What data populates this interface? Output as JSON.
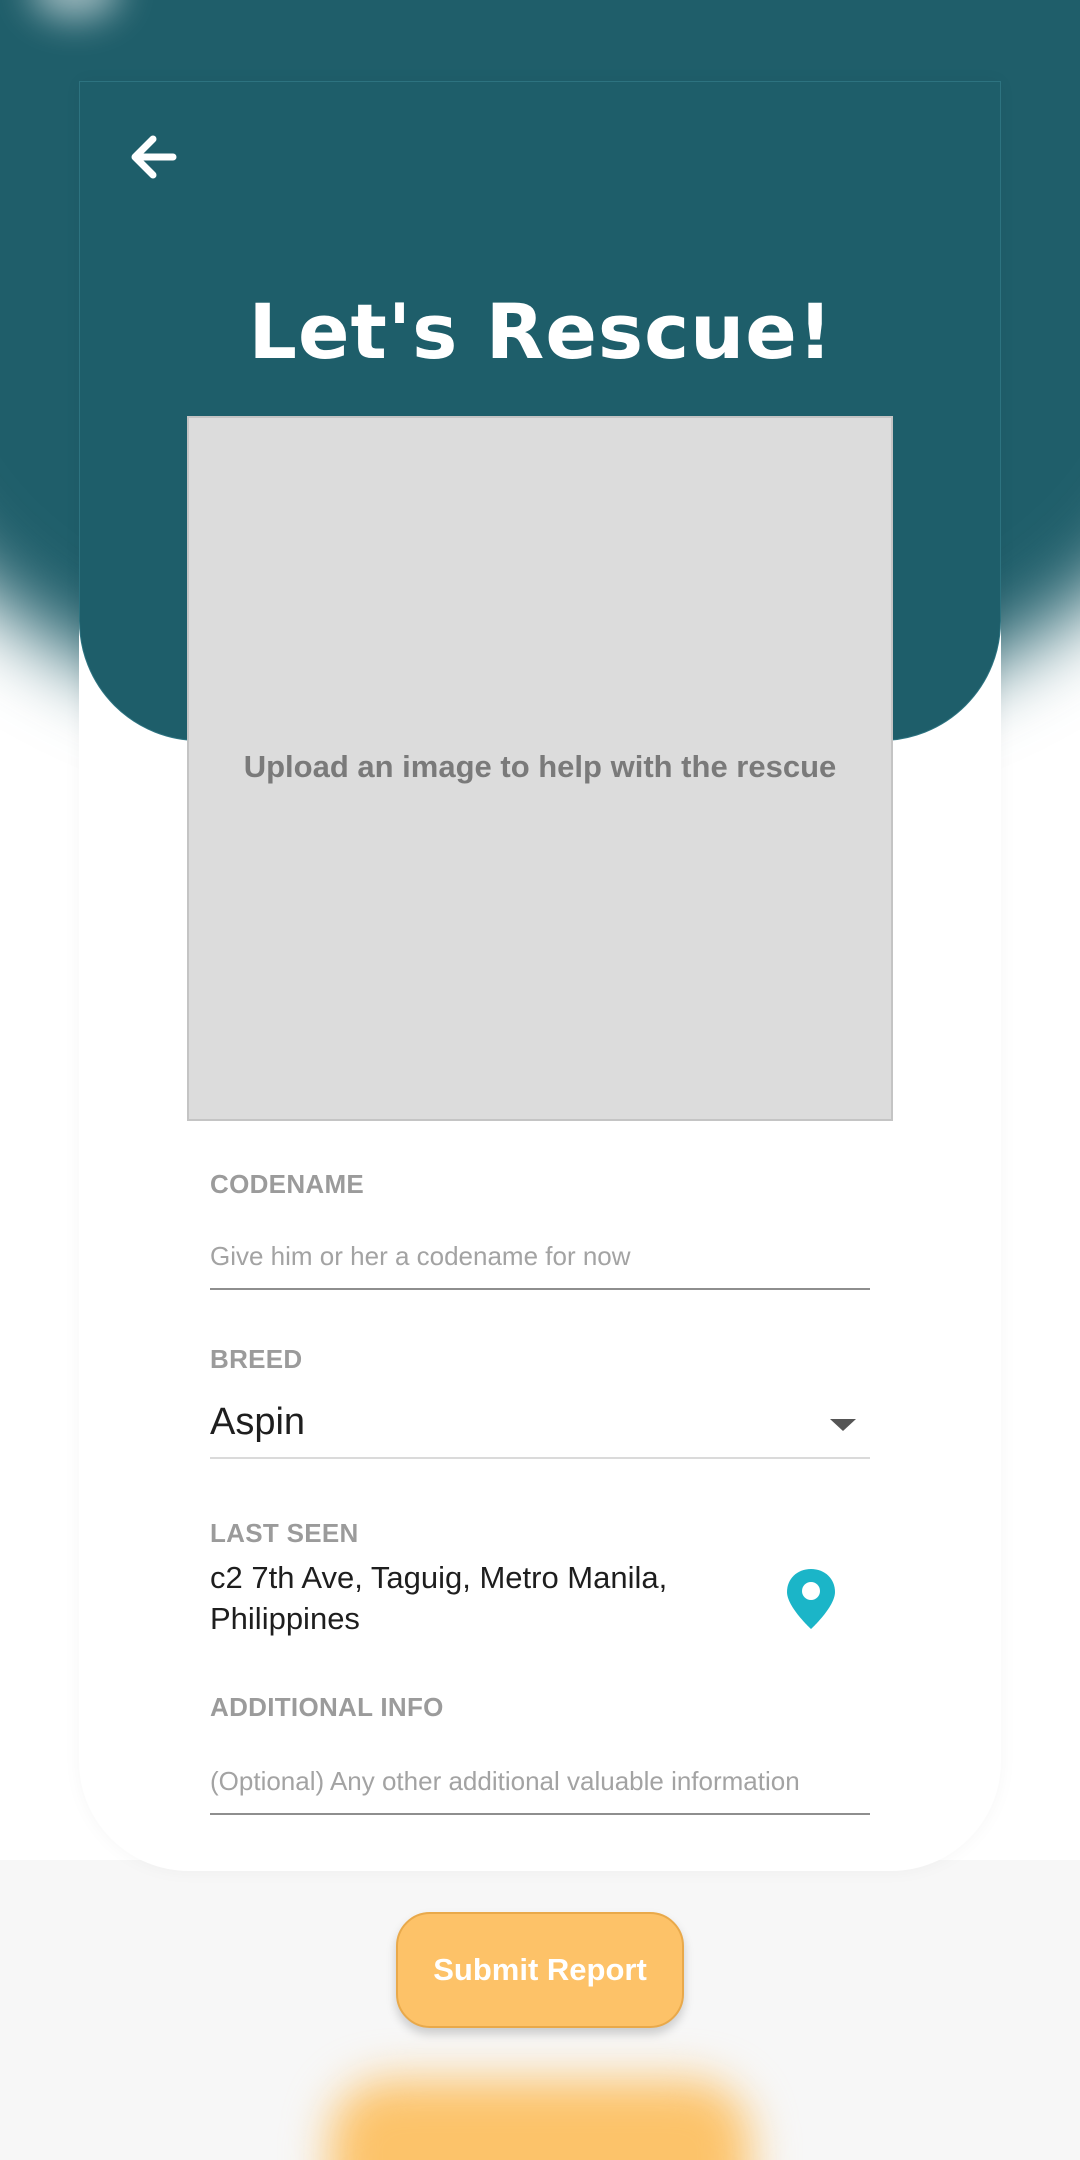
{
  "header": {
    "back_icon": "arrow-left-icon",
    "title": "Let's Rescue!"
  },
  "image_upload": {
    "prompt": "Upload an image to help with the rescue"
  },
  "form": {
    "codename": {
      "label": "CODENAME",
      "placeholder": "Give him or her a codename for now",
      "value": ""
    },
    "breed": {
      "label": "BREED",
      "selected": "Aspin"
    },
    "last_seen": {
      "label": "LAST SEEN",
      "value": "c2 7th Ave, Taguig, Metro Manila, Philippines",
      "icon": "map-pin-icon"
    },
    "additional_info": {
      "label": "ADDITIONAL INFO",
      "placeholder": "(Optional) Any other additional valuable information",
      "value": ""
    }
  },
  "submit": {
    "label": "Submit Report"
  },
  "colors": {
    "header_teal": "#1e5e6a",
    "accent_yellow": "#fdc268",
    "pin_cyan": "#1bb5c8"
  }
}
